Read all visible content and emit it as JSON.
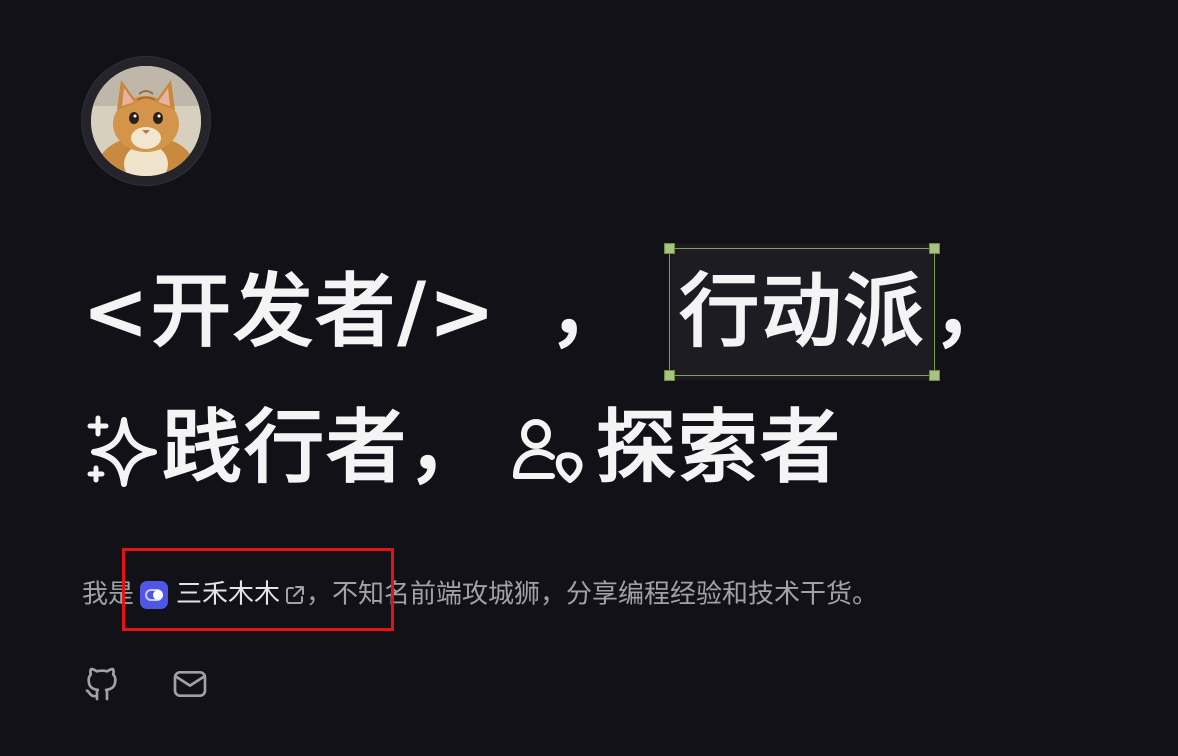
{
  "heading": {
    "line1_part1": "<开发者/>",
    "line1_sep": "，",
    "line1_selected": "行动派",
    "line1_end": "，",
    "line2_part1": "践行者，",
    "line2_part2": "探索者"
  },
  "bio": {
    "prefix": "我是",
    "author_name": "三禾木木",
    "suffix": "，不知名前端攻城狮，分享编程经验和技术干货。"
  },
  "icons": {
    "sparkle": "sparkles-icon",
    "users": "users-icon",
    "brand": "toggle-brand-icon",
    "external": "external-link-icon",
    "github": "github-icon",
    "mail": "mail-icon"
  },
  "colors": {
    "background": "#111117",
    "selection": "#7fa34a",
    "brand": "#4f56e6",
    "highlight": "#e51414"
  }
}
